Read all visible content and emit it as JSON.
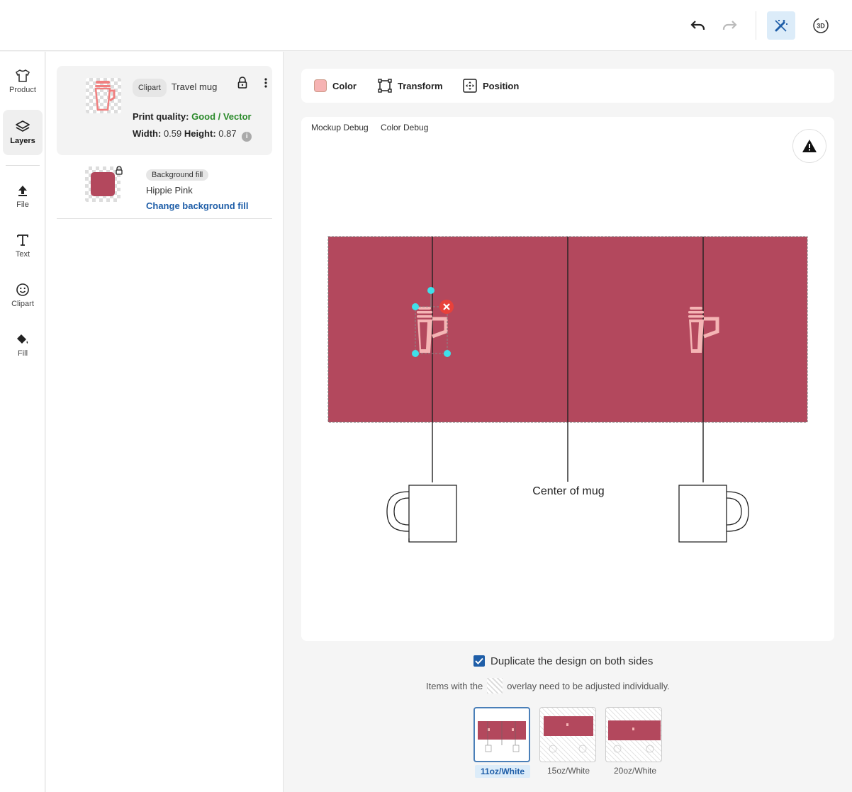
{
  "topbar": {
    "undo_icon": "undo-icon",
    "redo_icon": "redo-icon",
    "magic_icon": "magic-wand-icon",
    "view3d_label": "3D"
  },
  "rail": {
    "items": [
      {
        "label": "Product",
        "icon": "tshirt-icon"
      },
      {
        "label": "Layers",
        "icon": "layers-icon"
      },
      {
        "label": "File",
        "icon": "upload-icon"
      },
      {
        "label": "Text",
        "icon": "text-icon"
      },
      {
        "label": "Clipart",
        "icon": "smiley-icon"
      },
      {
        "label": "Fill",
        "icon": "paint-bucket-icon"
      }
    ]
  },
  "layers": {
    "clipart": {
      "chip": "Clipart",
      "name": "Travel mug",
      "quality_label": "Print quality:",
      "quality_value": "Good / Vector",
      "width_label": "Width:",
      "width_value": "0.59",
      "height_label": "Height:",
      "height_value": "0.87",
      "info_icon": "i"
    },
    "background": {
      "chip": "Background fill",
      "name": "Hippie Pink",
      "link": "Change background fill",
      "color": "#b3485d"
    }
  },
  "toolbar": {
    "color_label": "Color",
    "transform_label": "Transform",
    "position_label": "Position",
    "swatch_color": "#f6b3b3"
  },
  "canvas": {
    "mockup_debug": "Mockup Debug",
    "color_debug": "Color Debug",
    "center_label": "Center of mug",
    "print_area_color": "#b3485d"
  },
  "bottom": {
    "duplicate_label": "Duplicate the design on both sides",
    "duplicate_checked": true,
    "overlay_before": "Items with the",
    "overlay_after": "overlay need to be adjusted individually.",
    "variants": [
      "11oz/White",
      "15oz/White",
      "20oz/White"
    ],
    "selected_variant": "11oz/White"
  }
}
